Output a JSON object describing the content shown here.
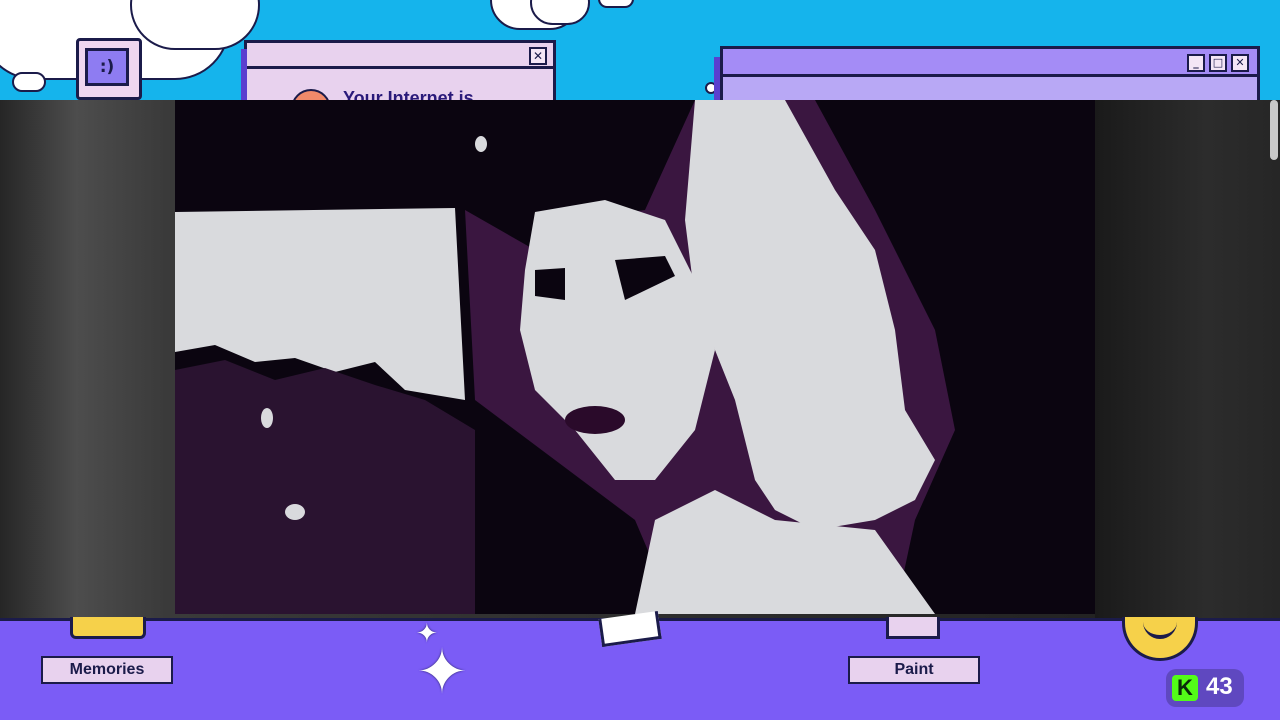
{
  "desktop": {
    "icons": [
      {
        "name": "computer-icon",
        "face": ":)"
      }
    ]
  },
  "popup_window": {
    "close_label": "✕",
    "message": "Your Internet is"
  },
  "right_window": {
    "min_label": "_",
    "max_label": "□",
    "close_label": "✕"
  },
  "taskbar": {
    "items": [
      {
        "label": "Memories"
      },
      {
        "label": "Paint"
      }
    ],
    "sparkles": [
      "✦",
      "✦"
    ]
  },
  "badge": {
    "icon": "K",
    "count": "43",
    "brand_color": "#53fc18"
  },
  "colors": {
    "sky": "#15b4ec",
    "taskbar": "#7b5cf6",
    "window_pink": "#e8d2ee",
    "outline": "#1b1b4a"
  }
}
